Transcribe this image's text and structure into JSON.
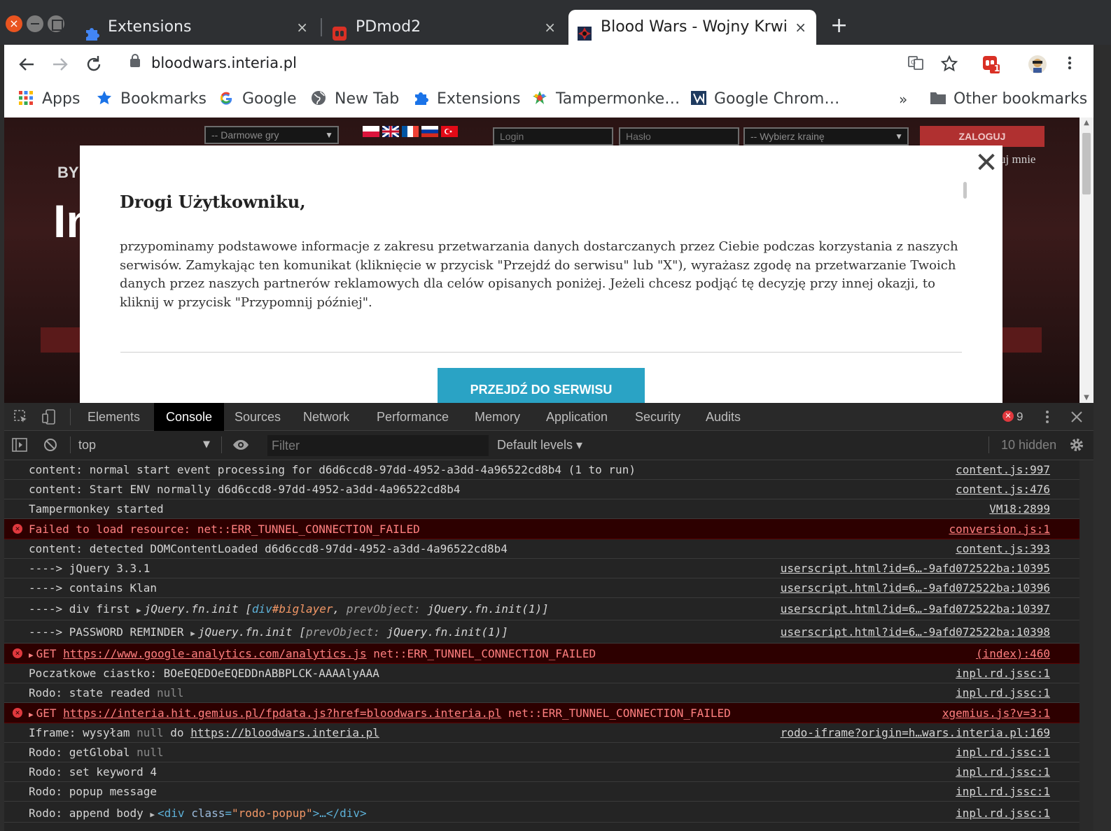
{
  "window": {
    "tabs": [
      {
        "title": "Extensions",
        "icon": "puzzle-icon",
        "active": false
      },
      {
        "title": "PDmod2",
        "icon": "pdmod-icon",
        "active": false
      },
      {
        "title": "Blood Wars - Wojny Krwi",
        "icon": "bloodwars-icon",
        "active": true
      }
    ],
    "close_glyph": "×",
    "new_tab_glyph": "+"
  },
  "toolbar": {
    "url": "bloodwars.interia.pl",
    "extension_badge": "1"
  },
  "bookmarks": [
    {
      "label": "Apps",
      "icon": "apps-grid-icon"
    },
    {
      "label": "Bookmarks",
      "icon": "star-icon"
    },
    {
      "label": "Google",
      "icon": "google-icon"
    },
    {
      "label": "New Tab",
      "icon": "globe-icon"
    },
    {
      "label": "Extensions",
      "icon": "puzzle-icon"
    },
    {
      "label": "Tampermonke…",
      "icon": "tampermonkey-icon"
    },
    {
      "label": "Google Chrom…",
      "icon": "chrome-store-icon"
    }
  ],
  "bookmarks_overflow": "»",
  "other_bookmarks": "Other bookmarks",
  "site": {
    "games_select": "-- Darmowe gry",
    "login_placeholder": "Login",
    "password_placeholder": "Hasło",
    "realm_select": "-- Wybierz krainę",
    "login_button": "ZALOGUJ",
    "remember_me": "uj mnie",
    "logo_small": "BY",
    "logo_big": "In"
  },
  "modal": {
    "close_glyph": "✕",
    "heading": "Drogi Użytkowniku,",
    "body": "przypominamy podstawowe informacje z zakresu przetwarzania danych dostarczanych przez Ciebie podczas korzystania z naszych serwisów. Zamykając ten komunikat (kliknięcie w przycisk \"Przejdź do serwisu\" lub \"X\"), wyrażasz zgodę na przetwarzanie Twoich danych przez naszych partnerów reklamowych dla celów opisanych poniżej. Jeżeli chcesz podjąć tę decyzję przy innej okazji, to kliknij w przycisk \"Przypomnij później\".",
    "button": "PRZEJDŹ DO SERWISU"
  },
  "devtools": {
    "tabs": [
      "Elements",
      "Console",
      "Sources",
      "Network",
      "Performance",
      "Memory",
      "Application",
      "Security",
      "Audits"
    ],
    "active_tab": "Console",
    "error_count": "9",
    "context": "top",
    "filter_placeholder": "Filter",
    "levels": "Default levels ▾",
    "hidden": "10 hidden",
    "colors": {
      "error_bg": "#2d0000",
      "error_text": "#ff8080",
      "link_blue": "#5db0d7"
    }
  },
  "console": {
    "r1": {
      "msg": "content: normal start event processing for d6d6ccd8-97dd-4952-a3dd-4a96522cd8b4 (1 to run)",
      "src": "content.js:997"
    },
    "r2": {
      "msg": "content: Start ENV normally d6d6ccd8-97dd-4952-a3dd-4a96522cd8b4",
      "src": "content.js:476"
    },
    "r3": {
      "msg": "Tampermonkey started",
      "src": "VM18:2899"
    },
    "r4": {
      "msg": "Failed to load resource: net::ERR_TUNNEL_CONNECTION_FAILED",
      "src": "conversion.js:1"
    },
    "r5": {
      "msg": "content: detected DOMContentLoaded d6d6ccd8-97dd-4952-a3dd-4a96522cd8b4",
      "src": "content.js:393"
    },
    "r6": {
      "msg": "----> jQuery 3.3.1",
      "src": "userscript.html?id=6…-9afd072522ba:10395"
    },
    "r7": {
      "msg": "----> contains Klan",
      "src": "userscript.html?id=6…-9afd072522ba:10396"
    },
    "r8": {
      "prefix": "----> div first ",
      "obj": "jQuery.fn.init",
      "open": " [",
      "tag": "div",
      "id": "#biglayer",
      "comma": ", ",
      "key": "prevObject",
      "colon": ": ",
      "val": "jQuery.fn.init(1)",
      "close": "]",
      "src": "userscript.html?id=6…-9afd072522ba:10397"
    },
    "r9": {
      "prefix": "----> PASSWORD REMINDER ",
      "obj": "jQuery.fn.init",
      "open": " [",
      "key": "prevObject",
      "colon": ": ",
      "val": "jQuery.fn.init(1)",
      "close": "]",
      "src": "userscript.html?id=6…-9afd072522ba:10398"
    },
    "r10": {
      "method": "GET ",
      "url": "https://www.google-analytics.com/analytics.js",
      "error": " net::ERR_TUNNEL_CONNECTION_FAILED",
      "src": "(index):460"
    },
    "r11": {
      "msg": "Poczatkowe ciastko: BOeEQEDOeEQEDDnABBPLCK-AAAAlyAAA",
      "src": "inpl.rd.jssc:1"
    },
    "r12": {
      "msg": "Rodo: state readed ",
      "null": "null",
      "src": "inpl.rd.jssc:1"
    },
    "r13": {
      "method": "GET ",
      "url": "https://interia.hit.gemius.pl/fpdata.js?href=bloodwars.interia.pl",
      "error": " net::ERR_TUNNEL_CONNECTION_FAILED",
      "src": "xgemius.js?v=3:1"
    },
    "r14": {
      "msg": "Iframe: wysyłam  ",
      "null": "null",
      "mid": " do ",
      "url": "https://bloodwars.interia.pl",
      "src": "rodo-iframe?origin=h…wars.interia.pl:169"
    },
    "r15": {
      "msg": "Rodo: getGlobal ",
      "null": "null",
      "src": "inpl.rd.jssc:1"
    },
    "r16": {
      "msg": "Rodo: set keyword 4",
      "src": "inpl.rd.jssc:1"
    },
    "r17": {
      "msg": "Rodo: popup message",
      "src": "inpl.rd.jssc:1"
    },
    "r18": {
      "msg": "Rodo: append body ",
      "tag_open": "<div ",
      "attr": "class",
      "eq": "=",
      "val": "\"rodo-popup\"",
      "tag_close": ">…</div>",
      "src": "inpl.rd.jssc:1"
    }
  }
}
